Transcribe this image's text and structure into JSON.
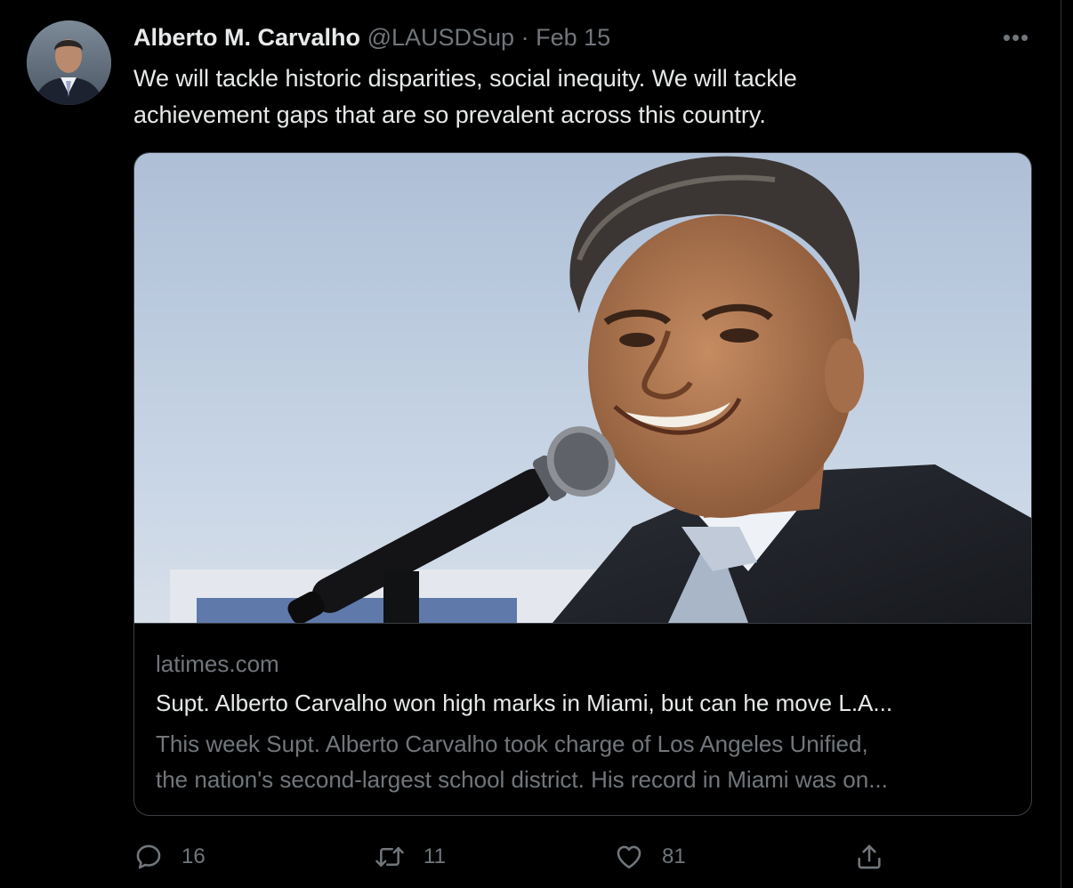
{
  "tweet": {
    "author_name": "Alberto M. Carvalho",
    "handle": "@LAUSDSup",
    "separator": "·",
    "date": "Feb 15",
    "more_label": "•••",
    "text_lines": [
      "We will tackle historic disparities, social inequity. We will tackle",
      "achievement gaps that are so prevalent across this country."
    ]
  },
  "card": {
    "domain": "latimes.com",
    "title": "Supt. Alberto Carvalho won high marks in Miami, but can he move L.A...",
    "description_lines": [
      "This week Supt. Alberto Carvalho took charge of Los Angeles Unified,",
      "the nation's second-largest school district. His record in Miami was on..."
    ]
  },
  "actions": {
    "reply_count": "16",
    "retweet_count": "11",
    "like_count": "81"
  },
  "icons": {
    "reply": "reply-icon",
    "retweet": "retweet-icon",
    "like": "heart-icon",
    "share": "share-icon",
    "more": "more-icon"
  },
  "colors": {
    "background": "#000000",
    "text_primary": "#e7e9ea",
    "text_secondary": "#71767b",
    "border": "#3a3f44"
  }
}
